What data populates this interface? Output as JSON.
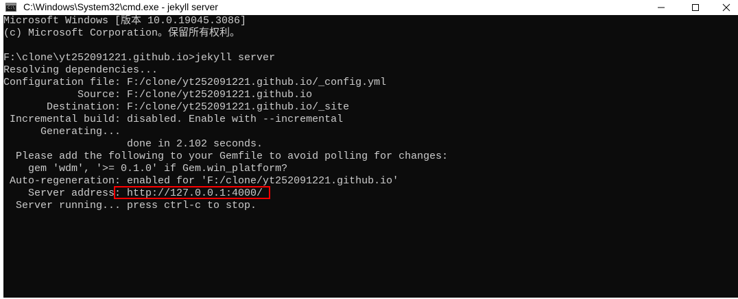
{
  "window": {
    "title": "C:\\Windows\\System32\\cmd.exe - jekyll  server",
    "icon_prompt": "C:\\"
  },
  "controls": {
    "minimize_icon": "minimize-icon",
    "maximize_icon": "maximize-icon",
    "close_icon": "close-icon"
  },
  "console": {
    "lines": [
      "Microsoft Windows [版本 10.0.19045.3086]",
      "(c) Microsoft Corporation。保留所有权利。",
      "",
      "F:\\clone\\yt252091221.github.io>jekyll server",
      "Resolving dependencies...",
      "Configuration file: F:/clone/yt252091221.github.io/_config.yml",
      "            Source: F:/clone/yt252091221.github.io",
      "       Destination: F:/clone/yt252091221.github.io/_site",
      " Incremental build: disabled. Enable with --incremental",
      "      Generating...",
      "                    done in 2.102 seconds.",
      "  Please add the following to your Gemfile to avoid polling for changes:",
      "    gem 'wdm', '>= 0.1.0' if Gem.win_platform?",
      " Auto-regeneration: enabled for 'F:/clone/yt252091221.github.io'",
      "    Server address: http://127.0.0.1:4000/",
      "  Server running... press ctrl-c to stop."
    ]
  },
  "colors": {
    "console_bg": "#0c0c0c",
    "console_text": "#cccccc",
    "highlight": "#ff0000"
  }
}
